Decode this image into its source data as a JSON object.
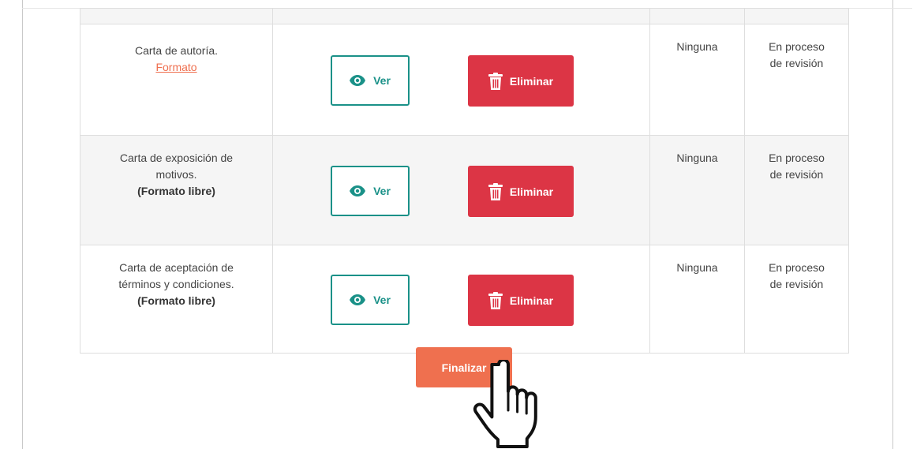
{
  "documents": {
    "rows": [
      {
        "name_line1": "Carta de autoría.",
        "name_line2": "",
        "format_text": "Formato",
        "format_is_link": true,
        "view_label": "Ver",
        "delete_label": "Eliminar",
        "observations": "Ninguna",
        "status_line1": "En proceso",
        "status_line2": "de revisión"
      },
      {
        "name_line1": "Carta de exposición de",
        "name_line2": "motivos.",
        "format_text": "(Formato libre)",
        "format_is_link": false,
        "view_label": "Ver",
        "delete_label": "Eliminar",
        "observations": "Ninguna",
        "status_line1": "En proceso",
        "status_line2": "de revisión"
      },
      {
        "name_line1": "Carta de aceptación de",
        "name_line2": "términos y condiciones.",
        "format_text": "(Formato libre)",
        "format_is_link": false,
        "view_label": "Ver",
        "delete_label": "Eliminar",
        "observations": "Ninguna",
        "status_line1": "En proceso",
        "status_line2": "de revisión"
      }
    ]
  },
  "actions": {
    "finalize_label": "Finalizar"
  },
  "icons": {
    "view": "eye-icon",
    "delete": "trash-icon",
    "cursor": "hand-pointer-cursor"
  },
  "colors": {
    "view_accent": "#1a9188",
    "delete_bg": "#dc3545",
    "finalize_bg": "#ef704f",
    "link": "#ef6f4f"
  }
}
